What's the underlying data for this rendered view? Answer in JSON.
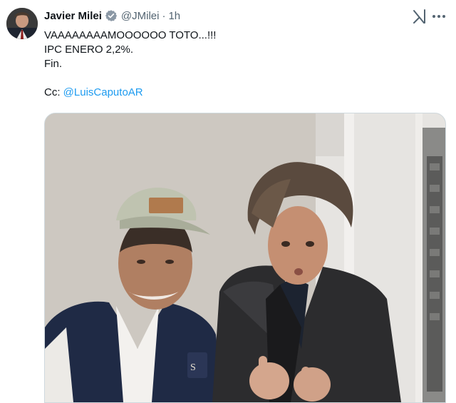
{
  "author": {
    "name": "Javier Milei",
    "handle": "@JMilei",
    "time": "1h",
    "separator": "·"
  },
  "icons": {
    "avatar": "avatar",
    "verified": "verified-badge-icon",
    "grok": "grok-icon",
    "more": "more-options-icon"
  },
  "tweet": {
    "line1": "VAAAAAAAAMOOOOOO TOTO...!!!",
    "line2": "IPC ENERO 2,2%.",
    "line3": "Fin.",
    "cc_prefix": "Cc: ",
    "mention": "@LuisCaputoAR"
  },
  "colors": {
    "text": "#0f1419",
    "secondary": "#536471",
    "link": "#1d9bf0",
    "border": "#cfd9de"
  }
}
